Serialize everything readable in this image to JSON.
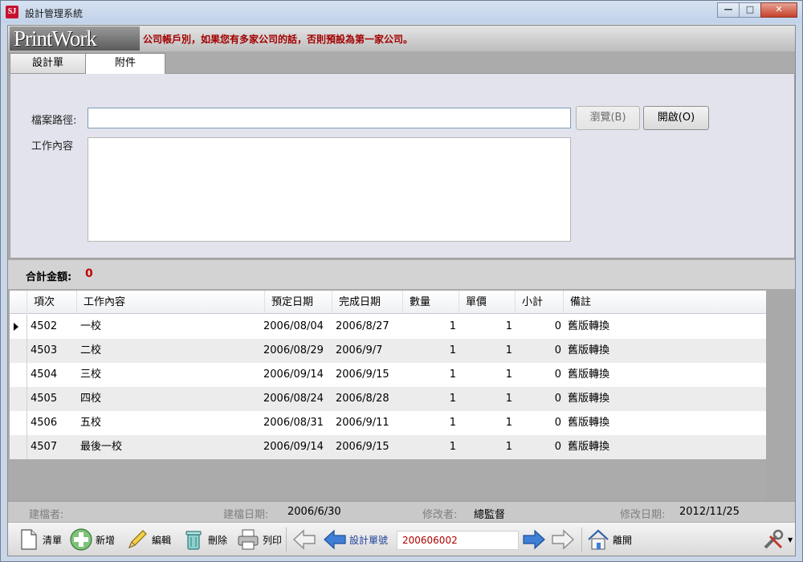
{
  "window": {
    "title": "設計管理系統",
    "app_icon_text": "SJ"
  },
  "brand": {
    "logo": "PrintWork",
    "note": "公司帳戶別，如果您有多家公司的話，否則預設為第一家公司。"
  },
  "tabs": [
    {
      "label": "設計單",
      "active": false
    },
    {
      "label": "附件",
      "active": true
    }
  ],
  "attachment": {
    "file_path_label": "檔案路徑:",
    "file_path_value": "",
    "browse_label": "瀏覽(B)",
    "open_label": "開啟(O)",
    "work_content_label": "工作內容",
    "work_content_value": ""
  },
  "total": {
    "label": "合計金額:",
    "value": "0"
  },
  "grid": {
    "columns": [
      "項次",
      "工作內容",
      "預定日期",
      "完成日期",
      "數量",
      "單價",
      "小計",
      "備註"
    ],
    "rows": [
      {
        "id": "4502",
        "work": "一校",
        "planned": "2006/08/04",
        "done": "2006/8/27",
        "qty": "1",
        "price": "1",
        "subtotal": "0",
        "note": "舊版轉換",
        "current": true
      },
      {
        "id": "4503",
        "work": "二校",
        "planned": "2006/08/29",
        "done": "2006/9/7",
        "qty": "1",
        "price": "1",
        "subtotal": "0",
        "note": "舊版轉換",
        "current": false
      },
      {
        "id": "4504",
        "work": "三校",
        "planned": "2006/09/14",
        "done": "2006/9/15",
        "qty": "1",
        "price": "1",
        "subtotal": "0",
        "note": "舊版轉換",
        "current": false
      },
      {
        "id": "4505",
        "work": "四校",
        "planned": "2006/08/24",
        "done": "2006/8/28",
        "qty": "1",
        "price": "1",
        "subtotal": "0",
        "note": "舊版轉換",
        "current": false
      },
      {
        "id": "4506",
        "work": "五校",
        "planned": "2006/08/31",
        "done": "2006/9/11",
        "qty": "1",
        "price": "1",
        "subtotal": "0",
        "note": "舊版轉換",
        "current": false
      },
      {
        "id": "4507",
        "work": "最後一校",
        "planned": "2006/09/14",
        "done": "2006/9/15",
        "qty": "1",
        "price": "1",
        "subtotal": "0",
        "note": "舊版轉換",
        "current": false
      }
    ]
  },
  "info": {
    "creator_label": "建檔者:",
    "creator_value": "",
    "created_label": "建檔日期:",
    "created_value": "2006/6/30",
    "modifier_label": "修改者:",
    "modifier_value": "總監督",
    "modified_label": "修改日期:",
    "modified_value": "2012/11/25"
  },
  "toolbar": {
    "clear_label": "清單",
    "add_label": "新增",
    "edit_label": "編輯",
    "delete_label": "刪除",
    "print_label": "列印",
    "record_label": "設計單號",
    "record_value": "200606002",
    "exit_label": "離開"
  },
  "colors": {
    "accent_red": "#c00000",
    "arrow_blue": "#3f7fd6"
  }
}
